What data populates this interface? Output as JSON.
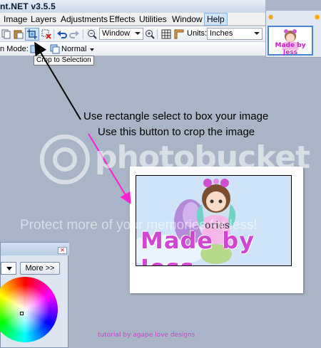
{
  "window": {
    "title": "nt.NET v3.5.5"
  },
  "menu": {
    "items": [
      "Image",
      "Layers",
      "Adjustments",
      "Effects",
      "Utilities",
      "Window",
      "Help"
    ]
  },
  "toolbar": {
    "zoom_label": "Window",
    "units_label": "Units:",
    "units_value": "Inches",
    "mode_label": "n Mode:",
    "mode_value": "Normal",
    "tooltip": "Crop to Selection"
  },
  "thumbnail": {
    "caption": "Made by Jess"
  },
  "annotations": {
    "line1": "Use rectangle select to box your image",
    "line2": "Use this button to crop the image"
  },
  "canvas": {
    "image_text_top": "ories",
    "image_text_main": "Made by Jess"
  },
  "color_panel": {
    "more_label": "More >>"
  },
  "footer": {
    "credit": "tutorial by agape love designs"
  },
  "watermark": {
    "brand": "photobucket",
    "tagline": "Protect more of your memories for less!"
  },
  "colors": {
    "arrow_black": "#000000",
    "arrow_magenta": "#ff1ed6",
    "selection_fill": "#cfe4f8",
    "text_magenta": "#c845c8"
  }
}
